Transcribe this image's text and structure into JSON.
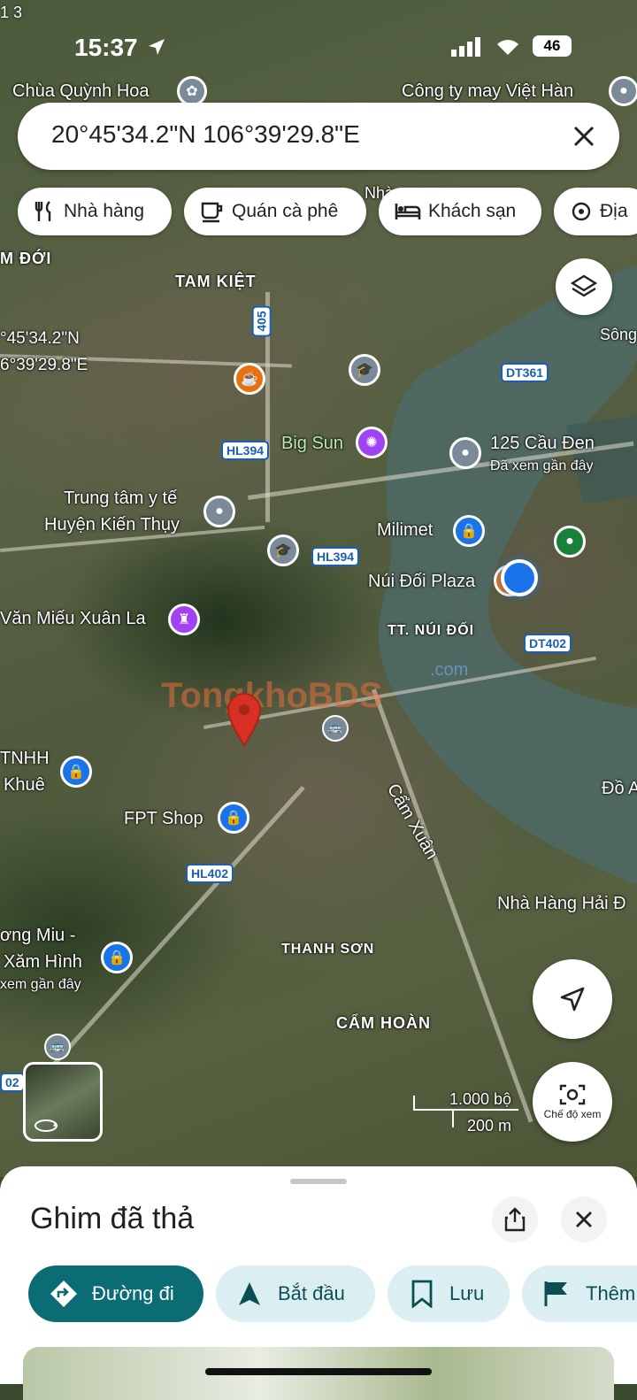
{
  "status": {
    "time": "15:37",
    "battery": "46",
    "corner": "1 3"
  },
  "search": {
    "coordinates": "20°45'34.2\"N 106°39'29.8\"E"
  },
  "chips": [
    {
      "label": "Nhà hàng",
      "icon": "restaurant-icon"
    },
    {
      "label": "Quán cà phê",
      "icon": "coffee-icon"
    },
    {
      "label": "Khách sạn",
      "icon": "hotel-icon"
    },
    {
      "label": "Địa",
      "icon": "attraction-icon"
    }
  ],
  "map": {
    "labels": {
      "chua": "Chùa Quỳnh Hoa",
      "congty": "Công ty may Việt Hàn",
      "mdoi": "M ĐỚI",
      "tamkiet": "TAM KIỆT",
      "coord1": "°45'34.2\"N",
      "coord2": "6°39'29.8\"E",
      "song": "Sông",
      "bigsun": "Big Sun",
      "caude": "125 Cầu Đen",
      "caude_sub": "Đã xem gần đây",
      "trungtam1": "Trung tâm y tế",
      "trungtam2": "Huyện Kiến Thụy",
      "milimet": "Milimet",
      "nuidoi_plaza": "Núi Đối Plaza",
      "vanmieu": "Văn Miếu Xuân La",
      "tt_nuidoi": "TT. NÚI ĐỐI",
      "tnhh": "TNHH",
      "khue": "Khuê",
      "fpt": "FPT Shop",
      "camxuan": "Cẩm Xuân",
      "do": "Đồ A",
      "nhahang": "Nhà Hàng Hải Đ",
      "thanhson": "THANH SƠN",
      "miu1": "ơng Miu -",
      "miu2": "Xăm Hình",
      "miu3": "xem gần đây",
      "camhoan": "CẨM HOÀN",
      "nha": "Nhà",
      "watermark": "TongkhoBDS",
      "watermark_com": ".com"
    },
    "shields": {
      "r405": "405",
      "hl394a": "HL394",
      "hl394b": "HL394",
      "dt361": "DT361",
      "dt402": "DT402",
      "hl402": "HL402",
      "r02": "02"
    },
    "scale": {
      "feet": "1.000 bộ",
      "meters": "200 m"
    },
    "view_mode": "Chế độ xem"
  },
  "sheet": {
    "title": "Ghim đã thả",
    "actions": [
      {
        "label": "Đường đi",
        "icon": "directions-icon"
      },
      {
        "label": "Bắt đầu",
        "icon": "navigation-arrow-icon"
      },
      {
        "label": "Lưu",
        "icon": "bookmark-icon"
      },
      {
        "label": "Thêm",
        "icon": "flag-icon"
      }
    ]
  },
  "colors": {
    "accent": "#0b6c74",
    "action_bg": "#dbeff3",
    "pin_red": "#d93025",
    "my_location": "#1a73e8"
  }
}
